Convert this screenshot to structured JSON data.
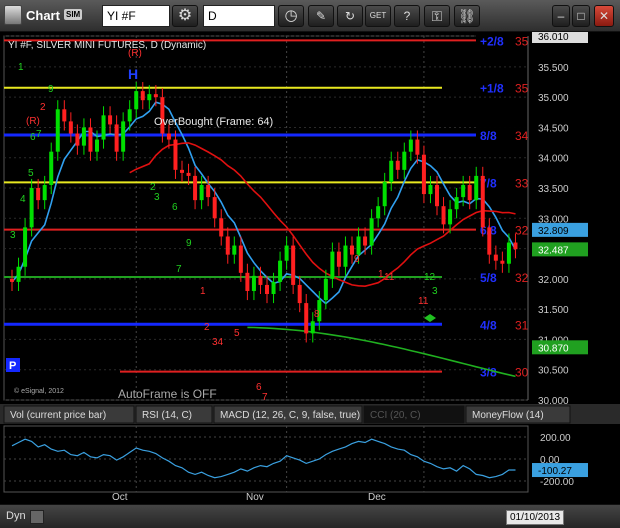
{
  "window": {
    "title": "Chart",
    "badge": "SIM",
    "symbol": "YI #F",
    "interval": "D"
  },
  "chart": {
    "header": "YI #F, SILVER MINI FUTURES, D (Dynamic)",
    "overbought_label": "OverBought (Frame: 64)",
    "autoframe_label": "AutoFrame is OFF",
    "copyright": "© eSignal, 2012",
    "h_marker": "H",
    "p_marker": "P"
  },
  "price_axis": {
    "ticks": [
      "36.010",
      "35.500",
      "35.000",
      "34.500",
      "34.000",
      "33.500",
      "33.000",
      "32.500",
      "32.000",
      "31.500",
      "31.000",
      "30.500",
      "30.000"
    ]
  },
  "murrey_levels": [
    {
      "label": "+2/8",
      "value": "35.938",
      "color": "#e02020",
      "label_color": "#2030ff"
    },
    {
      "label": "+1/8",
      "value": "35.156",
      "color": "#e8e820",
      "label_color": "#2030ff"
    },
    {
      "label": "8/8",
      "value": "34.375",
      "color": "#1428ff",
      "label_color": "#2030ff"
    },
    {
      "label": "7/8",
      "value": "33.594",
      "color": "#e8e820",
      "label_color": "#2030ff"
    },
    {
      "label": "6/8",
      "value": "32.813",
      "color": "#e02020",
      "label_color": "#2030ff"
    },
    {
      "label": "5/8",
      "value": "32.031",
      "color": "#20a020",
      "label_color": "#2030ff"
    },
    {
      "label": "4/8",
      "value": "31.250",
      "color": "#1428ff",
      "label_color": "#2030ff"
    },
    {
      "label": "3/8",
      "value": "30.469",
      "color": "#e02020",
      "label_color": "#2030ff"
    }
  ],
  "price_badges": [
    {
      "value": "32.809",
      "bg": "#3aa0e0",
      "fg": "#000"
    },
    {
      "value": "32.487",
      "bg": "#20a020",
      "fg": "#fff"
    },
    {
      "value": "30.870",
      "bg": "#20a020",
      "fg": "#fff"
    }
  ],
  "tabs": [
    {
      "label": "Vol (current price bar)",
      "active": false
    },
    {
      "label": "RSI (14, C)",
      "active": false
    },
    {
      "label": "MACD (12, 26, C, 9, false, true)",
      "active": false
    },
    {
      "label": "CCI (20, C)",
      "active": true
    },
    {
      "label": "MoneyFlow (14)",
      "active": false
    }
  ],
  "cci": {
    "axis_ticks": [
      "200.00",
      "0.00",
      "-200.00"
    ],
    "current_value": "-100.27"
  },
  "x_axis": {
    "labels": [
      "Oct",
      "Nov",
      "Dec"
    ]
  },
  "bottom": {
    "mode": "Dyn",
    "date": "01/10/2013"
  },
  "colors": {
    "up": "#00e000",
    "down": "#ff2020",
    "ma_fast": "#30a0f0",
    "ma_mid": "#e01010",
    "ma_slow": "#20b020"
  },
  "chart_data": {
    "type": "candlestick",
    "ylim": [
      30.0,
      36.01
    ],
    "cci_ylim": [
      -300,
      300
    ],
    "dates": [
      "Sep 4",
      "Sep 5",
      "Sep 6",
      "Sep 7",
      "Sep 10",
      "Sep 11",
      "Sep 12",
      "Sep 13",
      "Sep 14",
      "Sep 17",
      "Sep 18",
      "Sep 19",
      "Sep 20",
      "Sep 21",
      "Sep 24",
      "Sep 25",
      "Sep 26",
      "Sep 27",
      "Sep 28",
      "Oct 1",
      "Oct 2",
      "Oct 3",
      "Oct 4",
      "Oct 5",
      "Oct 8",
      "Oct 9",
      "Oct 10",
      "Oct 11",
      "Oct 12",
      "Oct 15",
      "Oct 16",
      "Oct 17",
      "Oct 18",
      "Oct 19",
      "Oct 22",
      "Oct 23",
      "Oct 24",
      "Oct 25",
      "Oct 26",
      "Oct 29",
      "Oct 30",
      "Oct 31",
      "Nov 1",
      "Nov 2",
      "Nov 5",
      "Nov 6",
      "Nov 7",
      "Nov 8",
      "Nov 9",
      "Nov 12",
      "Nov 13",
      "Nov 14",
      "Nov 15",
      "Nov 16",
      "Nov 19",
      "Nov 20",
      "Nov 21",
      "Nov 23",
      "Nov 26",
      "Nov 27",
      "Nov 28",
      "Nov 29",
      "Nov 30",
      "Dec 3",
      "Dec 4",
      "Dec 5",
      "Dec 6",
      "Dec 7",
      "Dec 10",
      "Dec 11",
      "Dec 12",
      "Dec 13",
      "Dec 14",
      "Dec 17",
      "Dec 18",
      "Dec 19",
      "Dec 20",
      "Dec 21"
    ],
    "open": [
      32.0,
      31.95,
      32.2,
      32.85,
      33.5,
      33.3,
      33.55,
      34.1,
      34.8,
      34.6,
      34.4,
      34.2,
      34.5,
      34.1,
      34.3,
      34.7,
      34.55,
      34.1,
      34.6,
      34.8,
      35.1,
      34.95,
      35.05,
      35.0,
      34.4,
      34.3,
      33.8,
      33.75,
      33.7,
      33.3,
      33.55,
      33.35,
      33.0,
      32.7,
      32.4,
      32.55,
      32.1,
      31.8,
      32.05,
      31.9,
      31.75,
      31.95,
      32.3,
      32.55,
      31.9,
      31.6,
      31.1,
      31.3,
      31.65,
      32.0,
      32.45,
      32.2,
      32.55,
      32.4,
      32.7,
      32.55,
      33.0,
      33.2,
      33.6,
      33.95,
      33.8,
      34.1,
      34.3,
      34.05,
      33.4,
      33.55,
      33.2,
      32.9,
      33.15,
      33.35,
      33.55,
      33.3,
      33.7,
      32.85,
      32.4,
      32.3,
      32.25,
      32.6
    ],
    "close": [
      31.95,
      32.2,
      32.85,
      33.5,
      33.3,
      33.55,
      34.1,
      34.8,
      34.6,
      34.4,
      34.2,
      34.5,
      34.1,
      34.3,
      34.7,
      34.55,
      34.1,
      34.6,
      34.8,
      35.1,
      34.95,
      35.05,
      35.0,
      34.4,
      34.3,
      33.8,
      33.75,
      33.7,
      33.3,
      33.55,
      33.35,
      33.0,
      32.7,
      32.4,
      32.55,
      32.1,
      31.8,
      32.05,
      31.9,
      31.75,
      31.95,
      32.3,
      32.55,
      31.9,
      31.6,
      31.1,
      31.3,
      31.65,
      32.0,
      32.45,
      32.2,
      32.55,
      32.4,
      32.7,
      32.55,
      33.0,
      33.2,
      33.6,
      33.95,
      33.8,
      34.1,
      34.3,
      34.05,
      33.4,
      33.55,
      33.2,
      32.9,
      33.15,
      33.35,
      33.55,
      33.3,
      33.7,
      32.85,
      32.4,
      32.3,
      32.25,
      32.6,
      32.49
    ],
    "cci": [
      120,
      150,
      180,
      160,
      110,
      130,
      90,
      70,
      80,
      40,
      30,
      60,
      20,
      10,
      40,
      30,
      -10,
      20,
      60,
      100,
      80,
      70,
      50,
      10,
      -20,
      -60,
      -80,
      -120,
      -140,
      -120,
      -150,
      -170,
      -160,
      -140,
      -120,
      -90,
      -110,
      -80,
      -60,
      -70,
      -40,
      -20,
      30,
      10,
      -10,
      -40,
      -20,
      0,
      40,
      70,
      90,
      110,
      140,
      160,
      150,
      180,
      160,
      140,
      110,
      90,
      80,
      40,
      20,
      -20,
      -40,
      -70,
      -90,
      -80,
      -110,
      -60,
      -90,
      -140,
      -150,
      -170,
      -160,
      -140,
      -100,
      -100.27
    ]
  }
}
